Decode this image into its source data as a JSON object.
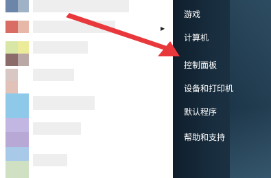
{
  "start_menu": {
    "right_items": [
      {
        "label": "游戏"
      },
      {
        "label": "计算机"
      },
      {
        "label": "控制面板"
      },
      {
        "label": "设备和打印机"
      },
      {
        "label": "默认程序"
      },
      {
        "label": "帮助和支持"
      }
    ],
    "left_items_blurred": true
  },
  "annotation": {
    "arrow_color": "#e8383b",
    "target": "控制面板"
  }
}
